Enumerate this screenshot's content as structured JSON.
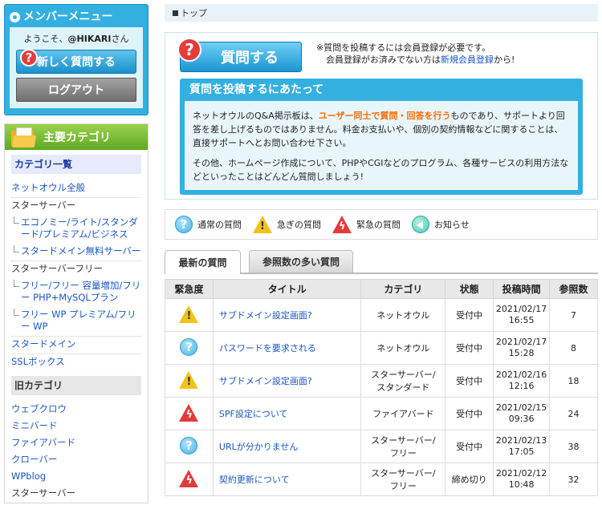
{
  "member": {
    "title": "メンバーメニュー",
    "welcome_prefix": "ようこそ、",
    "username": "@HIKARI",
    "welcome_suffix": "さん",
    "ask_label": "新しく質問する",
    "logout_label": "ログアウト"
  },
  "categories": {
    "title": "主要カテゴリ",
    "list_title": "カテゴリ一覧",
    "items": [
      {
        "label": "ネットオウル全般"
      },
      {
        "label": "スターサーバー"
      },
      {
        "label": "エコノミー/ライト/スタンダード/プレミアム/ビジネス"
      },
      {
        "label": "スタードメイン無料サーバー"
      },
      {
        "label": "スターサーバーフリー"
      },
      {
        "label": "フリー/フリー 容量増加/フリー PHP+MySQLプラン"
      },
      {
        "label": "フリー WP プレミアム/フリー WP"
      },
      {
        "label": "スタードメイン"
      },
      {
        "label": "SSLボックス"
      }
    ],
    "old_title": "旧カテゴリ",
    "old_items": [
      {
        "label": "ウェブクロウ"
      },
      {
        "label": "ミニバード"
      },
      {
        "label": "ファイアバード"
      },
      {
        "label": "クローバー"
      },
      {
        "label": "WPblog"
      },
      {
        "label": "スターサーバー"
      }
    ]
  },
  "breadcrumb": "トップ",
  "ask_panel": {
    "button_label": "質問する",
    "note_line1": "※質問を投稿するには会員登録が必要です。",
    "note_line2_prefix": "会員登録がお済みでない方は",
    "note_link": "新規会員登録",
    "note_line2_suffix": "から!",
    "info_title": "質問を投稿するにあたって",
    "info_p1_a": "ネットオウルのQ&A掲示板は、",
    "info_p1_hl": "ユーザー同士で質問・回答を行う",
    "info_p1_b": "ものであり、サポートより回答を差し上げるものではありません。料金お支払いや、個別の契約情報などに関することは、直接サポートへとお問い合わせ下さい。",
    "info_p2": "その他、ホームページ作成について、PHPやCGIなどのプログラム、各種サービスの利用方法などといったことはどんどん質問しましょう!"
  },
  "legend": {
    "normal": "通常の質問",
    "urgent": "急ぎの質問",
    "emergency": "緊急の質問",
    "notice": "お知らせ"
  },
  "tabs": {
    "latest": "最新の質問",
    "most_viewed": "参照数の多い質問"
  },
  "table": {
    "headers": {
      "urgency": "緊急度",
      "title": "タイトル",
      "category": "カテゴリ",
      "status": "状態",
      "posted": "投稿時間",
      "views": "参照数"
    },
    "rows": [
      {
        "urgency": "urgent",
        "title": "サブドメイン設定画面?",
        "cat1": "ネットオウル",
        "cat2": "",
        "status": "受付中",
        "date": "2021/02/17",
        "time": "16:55",
        "views": "7"
      },
      {
        "urgency": "normal",
        "title": "パスワードを要求される",
        "cat1": "ネットオウル",
        "cat2": "",
        "status": "受付中",
        "date": "2021/02/17",
        "time": "15:28",
        "views": "8"
      },
      {
        "urgency": "urgent",
        "title": "サブドメイン設定画面?",
        "cat1": "スターサーバー/",
        "cat2": "スタンダード",
        "status": "受付中",
        "date": "2021/02/16",
        "time": "12:16",
        "views": "18"
      },
      {
        "urgency": "emergency",
        "title": "SPF設定について",
        "cat1": "ファイアバード",
        "cat2": "",
        "status": "受付中",
        "date": "2021/02/15",
        "time": "09:36",
        "views": "24"
      },
      {
        "urgency": "normal",
        "title": "URLが分かりません",
        "cat1": "スターサーバー/",
        "cat2": "フリー",
        "status": "受付中",
        "date": "2021/02/13",
        "time": "17:05",
        "views": "38"
      },
      {
        "urgency": "emergency",
        "title": "契約更新について",
        "cat1": "スターサーバー/",
        "cat2": "フリー",
        "status": "締め切り",
        "date": "2021/02/12",
        "time": "10:48",
        "views": "32"
      }
    ]
  }
}
